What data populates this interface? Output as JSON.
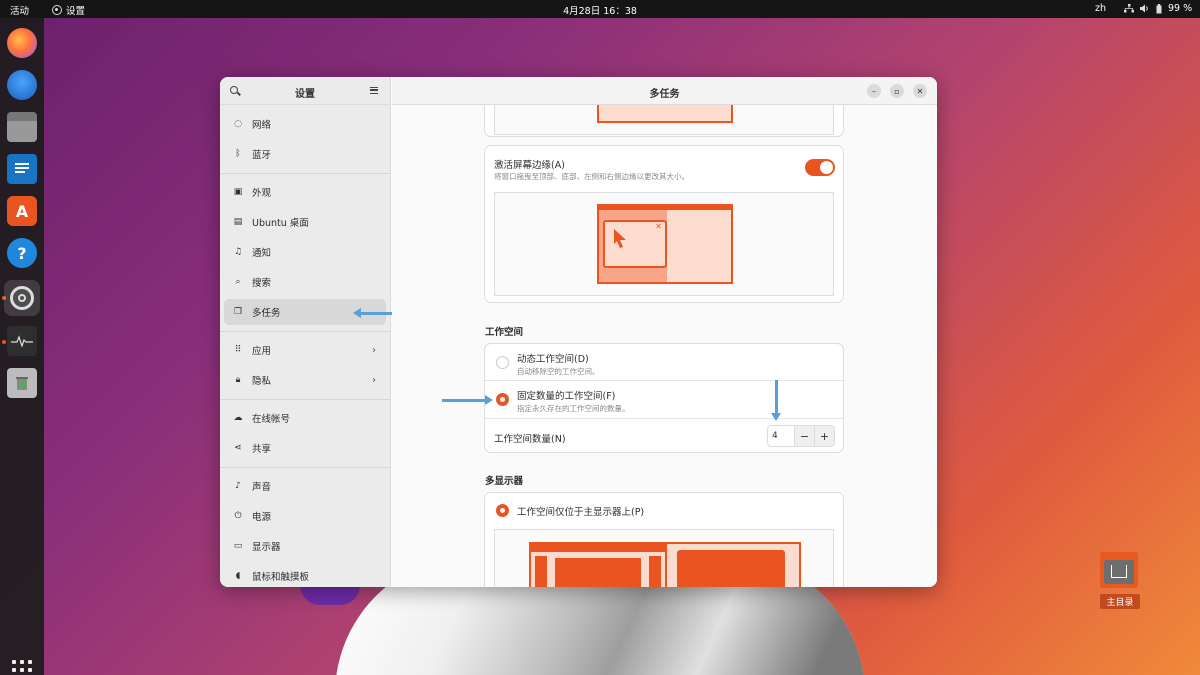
{
  "topbar": {
    "activities": "活动",
    "app_name": "设置",
    "clock": "4月28日  16：38",
    "lang": "zh",
    "battery": "99 %"
  },
  "dock": {
    "items": [
      "firefox-icon",
      "thunderbird-icon",
      "files-icon",
      "writer-icon",
      "app-center-icon",
      "help-icon",
      "settings-icon",
      "system-monitor-icon",
      "trash-icon"
    ],
    "show_apps": "show-apps-icon"
  },
  "desktop": {
    "home_label": "主目录"
  },
  "sidebar": {
    "title": "设置",
    "items": [
      {
        "label": "网络",
        "icon": "network-icon"
      },
      {
        "label": "蓝牙",
        "icon": "bluetooth-icon"
      },
      {
        "label": "外观",
        "icon": "appearance-icon"
      },
      {
        "label": "Ubuntu 桌面",
        "icon": "ubuntu-desktop-icon"
      },
      {
        "label": "通知",
        "icon": "bell-icon"
      },
      {
        "label": "搜索",
        "icon": "search-icon"
      },
      {
        "label": "多任务",
        "icon": "multitasking-icon"
      },
      {
        "label": "应用",
        "icon": "apps-icon"
      },
      {
        "label": "隐私",
        "icon": "lock-icon"
      },
      {
        "label": "在线帐号",
        "icon": "cloud-icon"
      },
      {
        "label": "共享",
        "icon": "share-icon"
      },
      {
        "label": "声音",
        "icon": "music-note-icon"
      },
      {
        "label": "电源",
        "icon": "power-icon"
      },
      {
        "label": "显示器",
        "icon": "display-icon"
      },
      {
        "label": "鼠标和触摸板",
        "icon": "mouse-icon"
      }
    ],
    "selected": "多任务"
  },
  "main": {
    "title": "多任务",
    "edge_tiling": {
      "label": "激活屏幕边缘(A)",
      "desc": "将窗口拖曳至顶部、底部、左侧和右侧边缘以更改其大小。",
      "enabled": true
    },
    "workspaces": {
      "section": "工作空间",
      "dynamic_label": "动态工作空间(D)",
      "dynamic_desc": "自动移除空的工作空间。",
      "fixed_label": "固定数量的工作空间(F)",
      "fixed_desc": "指定永久存在的工作空间的数量。",
      "selected": "fixed",
      "count_label": "工作空间数量(N)",
      "count_value": "4",
      "minus": "−",
      "plus": "+"
    },
    "multi_monitor": {
      "section": "多显示器",
      "primary_only_label": "工作空间仅位于主显示器上(P)",
      "selected": "primary_only"
    }
  },
  "colors": {
    "accent": "#e95420",
    "annotation_arrow": "#5aa0d6"
  }
}
